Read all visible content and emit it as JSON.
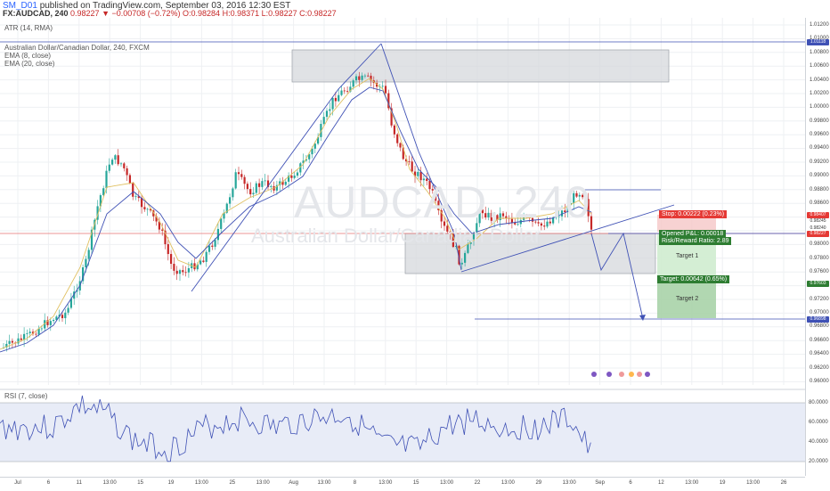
{
  "header": {
    "author": "SM_D01",
    "published": "published on TradingView.com, September 03, 2016 12:30 EST",
    "symbol_line": "FX:AUDCAD, 240",
    "ohlc": "0.98227 ▼ −0.00708 (−0.72%) O:0.98284 H:0.98371 L:0.98227 C:0.98227"
  },
  "panes": {
    "atr_label": "ATR (14, RMA)",
    "symbol_desc": "Australian Dollar/Canadian Dollar, 240, FXCM",
    "ema8": "EMA (8, close)",
    "ema20": "EMA (20, close)",
    "rsi_label": "RSI (7, close)"
  },
  "watermark": {
    "big": "AUDCAD, 240",
    "small": "Australian Dollar/Canadian Dollar"
  },
  "trade": {
    "stop": "Stop: 0.00222 (0.23%)",
    "opened": "Opened P&L: 0.00018",
    "rr": "Risk/Reward Ratio: 2.89",
    "target": "Target: 0.00642 (0.65%)",
    "target1": "Target 1",
    "target2": "Target 2"
  },
  "price_axis": [
    "1.01200",
    "1.01000",
    "1.00800",
    "1.00600",
    "1.00400",
    "1.00200",
    "1.00000",
    "0.99800",
    "0.99600",
    "0.99400",
    "0.99200",
    "0.99000",
    "0.98800",
    "0.98600",
    "0.98400",
    "0.98200",
    "0.98000",
    "0.97800",
    "0.97600",
    "0.97400",
    "0.97200",
    "0.97000",
    "0.96800",
    "0.96600",
    "0.96400",
    "0.96200",
    "0.96000"
  ],
  "price_labels": {
    "top": "1.01118",
    "stop": "0.98407",
    "p1": "0.98245",
    "p2": "0.98240",
    "cur": "0.98227",
    "target": "0.97603",
    "bottom": "0.96898"
  },
  "rsi_axis": [
    "80.0000",
    "60.0000",
    "40.0000",
    "20.0000"
  ],
  "time_axis": [
    "Jul",
    "6",
    "11",
    "13:00",
    "15",
    "19",
    "13:00",
    "25",
    "13:00",
    "Aug",
    "13:00",
    "8",
    "13:00",
    "15",
    "13:00",
    "22",
    "13:00",
    "29",
    "13:00",
    "Sep",
    "6",
    "12",
    "13:00",
    "19",
    "13:00",
    "26"
  ],
  "colors": {
    "up": "#26a69a",
    "down": "#c62828",
    "line": "#5c6bc0",
    "ema_fast": "#e0c060"
  }
}
